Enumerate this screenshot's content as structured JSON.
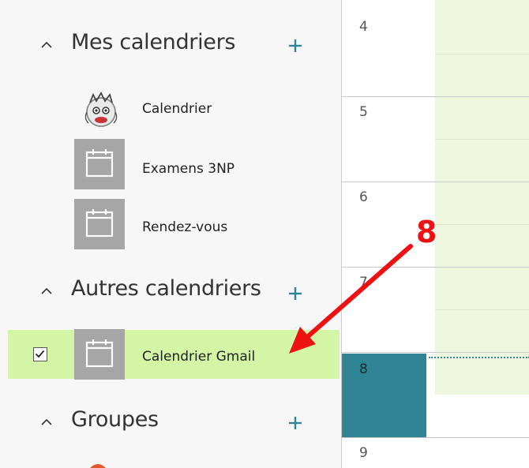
{
  "sections": {
    "mine": {
      "title": "Mes calendriers"
    },
    "others": {
      "title": "Autres calendriers"
    },
    "groups": {
      "title": "Groupes"
    }
  },
  "calendars": {
    "mine": [
      {
        "label": "Calendrier",
        "icon": "avatar"
      },
      {
        "label": "Examens 3NP",
        "icon": "calendar-icon"
      },
      {
        "label": "Rendez-vous",
        "icon": "calendar-icon"
      }
    ],
    "others": [
      {
        "label": "Calendrier Gmail",
        "icon": "calendar-icon",
        "checked": true
      }
    ]
  },
  "grid": {
    "hours": [
      "4",
      "5",
      "6",
      "7",
      "8",
      "9"
    ],
    "current_hour": "8"
  },
  "annotation": {
    "label": "8",
    "color": "#ee1111"
  },
  "colors": {
    "accent": "#2f8596",
    "plus": "#2f8596",
    "selected_bg": "#d4f5a6",
    "tile": "#a6a6a6"
  }
}
